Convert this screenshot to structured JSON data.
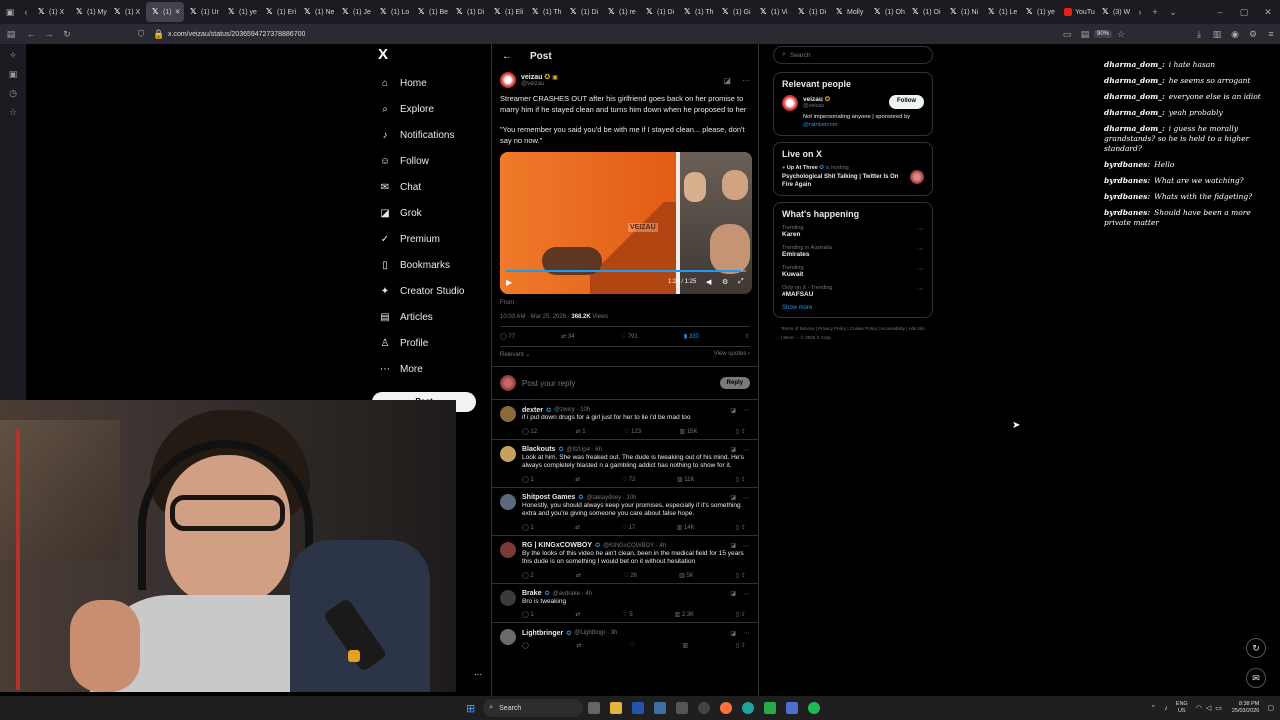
{
  "browser": {
    "tabs": [
      {
        "label": "(1) X",
        "icon": "x-icon"
      },
      {
        "label": "(1) My",
        "icon": "x-icon"
      },
      {
        "label": "(1) X",
        "icon": "x-icon"
      },
      {
        "label": "(1)",
        "icon": "x-icon",
        "active": true
      },
      {
        "label": "(1) Ur",
        "icon": "x-icon"
      },
      {
        "label": "(1) ye",
        "icon": "x-icon"
      },
      {
        "label": "(1) Eri",
        "icon": "x-icon"
      },
      {
        "label": "(1) Ne",
        "icon": "x-icon"
      },
      {
        "label": "(1) Je",
        "icon": "x-icon"
      },
      {
        "label": "(1) Lo",
        "icon": "x-icon"
      },
      {
        "label": "(1) Be",
        "icon": "x-icon"
      },
      {
        "label": "(1) Di",
        "icon": "x-icon"
      },
      {
        "label": "(1) Eli",
        "icon": "x-icon"
      },
      {
        "label": "(1) Th",
        "icon": "x-icon"
      },
      {
        "label": "(1) Di",
        "icon": "x-icon"
      },
      {
        "label": "(1) re",
        "icon": "x-icon"
      },
      {
        "label": "(1) Di",
        "icon": "x-icon"
      },
      {
        "label": "(1) Th",
        "icon": "x-icon"
      },
      {
        "label": "(1) Gi",
        "icon": "x-icon"
      },
      {
        "label": "(1) Vi",
        "icon": "x-icon"
      },
      {
        "label": "(1) Di",
        "icon": "x-icon"
      },
      {
        "label": "Molly",
        "icon": "x-icon"
      },
      {
        "label": "(1) Oh",
        "icon": "x-icon"
      },
      {
        "label": "(1) Oi",
        "icon": "x-icon"
      },
      {
        "label": "(1) Ni",
        "icon": "x-icon"
      },
      {
        "label": "(1) Le",
        "icon": "x-icon"
      },
      {
        "label": "(1) ye",
        "icon": "x-icon"
      },
      {
        "label": "YouTu",
        "icon": "youtube-icon"
      },
      {
        "label": "(3) W",
        "icon": "x-icon"
      }
    ],
    "url": "x.com/veizau/status/2036594727378886700",
    "zoom": "90%"
  },
  "nav": {
    "logo": "X",
    "items": [
      {
        "label": "Home",
        "icon": "home-icon",
        "glyph": "⌂"
      },
      {
        "label": "Explore",
        "icon": "search-icon",
        "glyph": "⌕"
      },
      {
        "label": "Notifications",
        "icon": "bell-icon",
        "glyph": "♪"
      },
      {
        "label": "Follow",
        "icon": "person-plus-icon",
        "glyph": "☺"
      },
      {
        "label": "Chat",
        "icon": "mail-icon",
        "glyph": "✉"
      },
      {
        "label": "Grok",
        "icon": "grok-icon",
        "glyph": "◪"
      },
      {
        "label": "Premium",
        "icon": "premium-icon",
        "glyph": "✓"
      },
      {
        "label": "Bookmarks",
        "icon": "bookmark-icon",
        "glyph": "▯"
      },
      {
        "label": "Creator Studio",
        "icon": "creator-icon",
        "glyph": "✦"
      },
      {
        "label": "Articles",
        "icon": "articles-icon",
        "glyph": "▤"
      },
      {
        "label": "Profile",
        "icon": "profile-icon",
        "glyph": "♙"
      },
      {
        "label": "More",
        "icon": "more-icon",
        "glyph": "⋯"
      }
    ],
    "post_button": "Post"
  },
  "post": {
    "header": "Post",
    "author_name": "veizau",
    "author_handle": "@veizau",
    "text": "Streamer CRASHES OUT after his girlfriend goes back on her promise to marry him if he stayed clean and turns him down when he proposed to her",
    "quote": "\"You remember you said you'd be with me if I stayed clean... please, don't say no now.\"",
    "video_watermark": "VEIZAU",
    "video_time": "1:24 / 1:25",
    "from": "From",
    "timestamp": "10:03 AM · Mar 25, 2026 ·",
    "views_count": "368.2K",
    "views_label": "Views",
    "stats": {
      "replies": "77",
      "reposts": "34",
      "likes": "791",
      "bookmarks": "330"
    },
    "sort_label": "Relevant",
    "view_quotes": "View quotes",
    "reply_placeholder": "Post your reply",
    "reply_button": "Reply"
  },
  "replies": [
    {
      "name": "dexter",
      "handle": "@zwicy · 10h",
      "text": "if i put down drugs for a girl just for her to lie i'd be mad too",
      "replies": "12",
      "reposts": "1",
      "likes": "123",
      "views": "15K"
    },
    {
      "name": "Blackouts",
      "handle": "@ItzUp4 · 6h",
      "text": "Look at him. She was freaked out. The dude is tweaking out of his mind. He's always completely blasted n a gambling addict has nothing to show for it.",
      "replies": "1",
      "reposts": "",
      "likes": "72",
      "views": "11K"
    },
    {
      "name": "Shitpost Games",
      "handle": "@takiaydney · 10h",
      "text": "Honestly, you should always keep your promises, especially if it's something extra and you're giving someone you care about false hope.",
      "replies": "1",
      "reposts": "",
      "likes": "17",
      "views": "14K"
    },
    {
      "name": "RG | KINGxCOWBOY",
      "handle": "@KINGxCOWBOY · 4h",
      "text": "By the looks of this video he ain't clean, been in the medical field for 15 years this dude is on something I would bet on it without hesitation",
      "replies": "2",
      "reposts": "",
      "likes": "26",
      "views": "5K"
    },
    {
      "name": "Brake",
      "handle": "@avdrake · 4h",
      "text": "Bro is tweaking",
      "replies": "1",
      "reposts": "",
      "likes": "5",
      "views": "2.3K"
    },
    {
      "name": "Lightbringer",
      "handle": "@Lightbngr · 3h",
      "text": "",
      "replies": "",
      "reposts": "",
      "likes": "",
      "views": ""
    }
  ],
  "right": {
    "search_placeholder": "Search",
    "relevant_title": "Relevant people",
    "person_name": "veizau",
    "person_handle": "@veizau",
    "follow_label": "Follow",
    "person_bio": "Not impersonating anyone | sponsored by",
    "person_bio_link": "@rainbetcom",
    "live_title": "Live on X",
    "live_host": "Up At Three",
    "live_status": "is hosting",
    "live_text": "Psychological Shit Talking | Twitter Is On Fire Again",
    "happening_title": "What's happening",
    "trends": [
      {
        "category": "Trending",
        "title": "Karen"
      },
      {
        "category": "Trending in Australia",
        "title": "Emirates"
      },
      {
        "category": "Trending",
        "title": "Kuwait"
      },
      {
        "category": "Only on X · Trending",
        "title": "#MAFSAU"
      }
    ],
    "show_more": "Show more",
    "footer": "Terms of Service | Privacy Policy | Cookie Policy | Accessibility | Ads info | More ··· © 2026 X Corp."
  },
  "chat": [
    {
      "user": "dharma_dom_:",
      "msg": "i hate hasan"
    },
    {
      "user": "dharma_dom_:",
      "msg": "he seems so arrogant"
    },
    {
      "user": "dharma_dom_:",
      "msg": "everyone else is an idiot"
    },
    {
      "user": "dharma_dom_:",
      "msg": "yeah probably"
    },
    {
      "user": "dharma_dom_:",
      "msg": "i guess he morally grandstands? so he is held to a higher standard?"
    },
    {
      "user": "byrdbanes:",
      "msg": "Hello"
    },
    {
      "user": "byrdbanes:",
      "msg": "What are we watching?"
    },
    {
      "user": "byrdbanes:",
      "msg": "Whats with the fidgeting?"
    },
    {
      "user": "byrdbanes:",
      "msg": "Should have been a more private matter"
    }
  ],
  "taskbar": {
    "search_label": "Search",
    "lang": "ENG",
    "region": "US",
    "time": "8:38 PM",
    "date": "25/03/2026"
  },
  "colors": {
    "accent": "#1d9bf0",
    "background": "#000000",
    "border": "#2f3336",
    "video_orange": "#e8631f"
  }
}
